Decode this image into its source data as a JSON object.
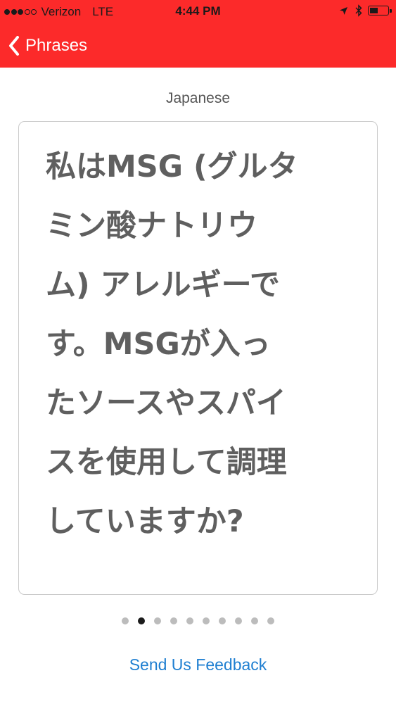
{
  "status_bar": {
    "carrier": "Verizon",
    "network": "LTE",
    "time": "4:44 PM",
    "signal_bars_filled": 3,
    "signal_bars_total": 5,
    "battery_level": 0.45
  },
  "nav": {
    "back_label": "Phrases",
    "back_icon": "chevron-left-icon"
  },
  "phrase": {
    "language": "Japanese",
    "lines": [
      "私はMSG (グルタ",
      "ミン酸ナトリウ",
      "ム) アレルギーで",
      "す。MSGが入っ",
      "たソースやスパイ",
      "スを使用して調理",
      "していますか?"
    ]
  },
  "pager": {
    "total_pages": 10,
    "current_page": 2
  },
  "footer": {
    "feedback_label": "Send Us Feedback"
  },
  "colors": {
    "header_bg": "#fc2a2a",
    "link": "#1f7fd1",
    "phrase_text": "#5f5f5f",
    "dot_inactive": "#bcbcbc",
    "dot_active": "#1b1b1b"
  }
}
